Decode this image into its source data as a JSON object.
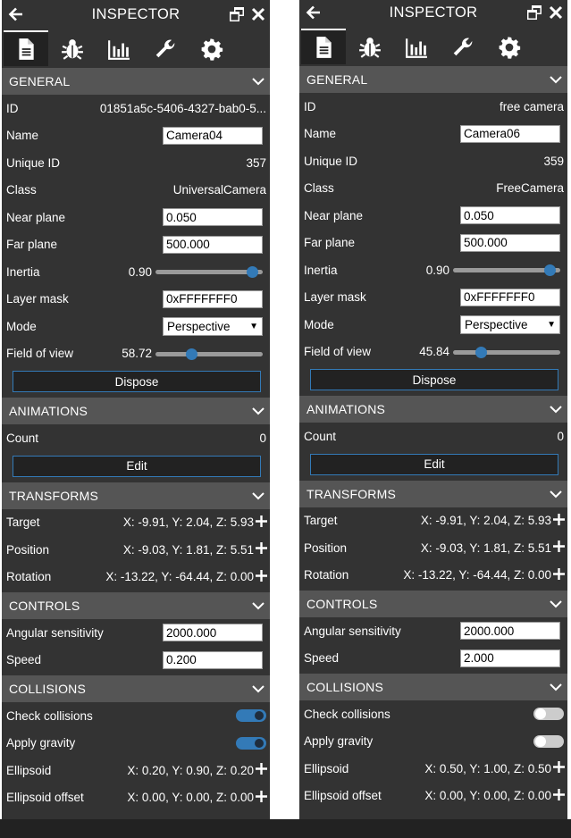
{
  "panels": [
    {
      "title": "INSPECTOR",
      "sections": {
        "general": "GENERAL",
        "animations": "ANIMATIONS",
        "transforms": "TRANSFORMS",
        "controls": "CONTROLS",
        "collisions": "COLLISIONS"
      },
      "general": {
        "id_label": "ID",
        "id_value": "01851a5c-5406-4327-bab0-5...",
        "name_label": "Name",
        "name_value": "Camera04",
        "uid_label": "Unique ID",
        "uid_value": "357",
        "class_label": "Class",
        "class_value": "UniversalCamera",
        "near_label": "Near plane",
        "near_value": "0.050",
        "far_label": "Far plane",
        "far_value": "500.000",
        "inertia_label": "Inertia",
        "inertia_value": "0.90",
        "inertia_fraction": 0.9,
        "layer_label": "Layer mask",
        "layer_value": "0xFFFFFFF0",
        "mode_label": "Mode",
        "mode_value": "Perspective",
        "fov_label": "Field of view",
        "fov_value": "58.72",
        "fov_fraction": 0.33,
        "dispose_label": "Dispose"
      },
      "animations": {
        "count_label": "Count",
        "count_value": "0",
        "edit_label": "Edit"
      },
      "transforms": {
        "target_label": "Target",
        "target_value": "X: -9.91, Y: 2.04, Z: 5.93",
        "position_label": "Position",
        "position_value": "X: -9.03, Y: 1.81, Z: 5.51",
        "rotation_label": "Rotation",
        "rotation_value": "X: -13.22, Y: -64.44, Z: 0.00"
      },
      "controls": {
        "angular_label": "Angular sensitivity",
        "angular_value": "2000.000",
        "speed_label": "Speed",
        "speed_value": "0.200"
      },
      "collisions": {
        "check_label": "Check collisions",
        "check_on": true,
        "gravity_label": "Apply gravity",
        "gravity_on": true,
        "ellipsoid_label": "Ellipsoid",
        "ellipsoid_value": "X: 0.20, Y: 0.90, Z: 0.20",
        "offset_label": "Ellipsoid offset",
        "offset_value": "X: 0.00, Y: 0.00, Z: 0.00"
      }
    },
    {
      "title": "INSPECTOR",
      "sections": {
        "general": "GENERAL",
        "animations": "ANIMATIONS",
        "transforms": "TRANSFORMS",
        "controls": "CONTROLS",
        "collisions": "COLLISIONS"
      },
      "general": {
        "id_label": "ID",
        "id_value": "free camera",
        "name_label": "Name",
        "name_value": "Camera06",
        "uid_label": "Unique ID",
        "uid_value": "359",
        "class_label": "Class",
        "class_value": "FreeCamera",
        "near_label": "Near plane",
        "near_value": "0.050",
        "far_label": "Far plane",
        "far_value": "500.000",
        "inertia_label": "Inertia",
        "inertia_value": "0.90",
        "inertia_fraction": 0.9,
        "layer_label": "Layer mask",
        "layer_value": "0xFFFFFFF0",
        "mode_label": "Mode",
        "mode_value": "Perspective",
        "fov_label": "Field of view",
        "fov_value": "45.84",
        "fov_fraction": 0.26,
        "dispose_label": "Dispose"
      },
      "animations": {
        "count_label": "Count",
        "count_value": "0",
        "edit_label": "Edit"
      },
      "transforms": {
        "target_label": "Target",
        "target_value": "X: -9.91, Y: 2.04, Z: 5.93",
        "position_label": "Position",
        "position_value": "X: -9.03, Y: 1.81, Z: 5.51",
        "rotation_label": "Rotation",
        "rotation_value": "X: -13.22, Y: -64.44, Z: 0.00"
      },
      "controls": {
        "angular_label": "Angular sensitivity",
        "angular_value": "2000.000",
        "speed_label": "Speed",
        "speed_value": "2.000"
      },
      "collisions": {
        "check_label": "Check collisions",
        "check_on": false,
        "gravity_label": "Apply gravity",
        "gravity_on": false,
        "ellipsoid_label": "Ellipsoid",
        "ellipsoid_value": "X: 0.50, Y: 1.00, Z: 0.50",
        "offset_label": "Ellipsoid offset",
        "offset_value": "X: 0.00, Y: 0.00, Z: 0.00"
      }
    }
  ],
  "tabs": [
    {
      "icon": "document-icon",
      "active": true
    },
    {
      "icon": "bug-icon",
      "active": false
    },
    {
      "icon": "bar-chart-icon",
      "active": false
    },
    {
      "icon": "wrench-icon",
      "active": false
    },
    {
      "icon": "gear-icon",
      "active": false
    }
  ],
  "colors": {
    "panel": "#333333",
    "header": "#555555",
    "accent": "#337ab7",
    "tab_active": "#222222"
  }
}
